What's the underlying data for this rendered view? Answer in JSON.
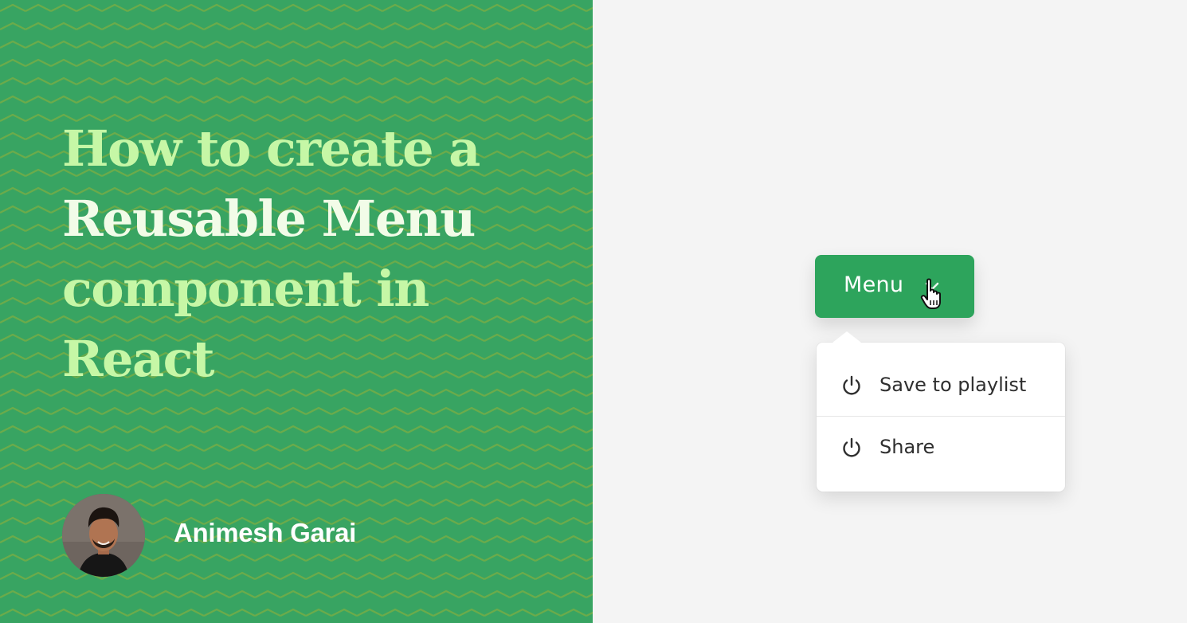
{
  "title": {
    "lines": [
      {
        "text": "How to create a",
        "color": "#c6f7a6"
      },
      {
        "text": "Reusable Menu",
        "color": "#f2fce8"
      },
      {
        "text": "component in",
        "color": "#c6f7a6"
      },
      {
        "text": "React",
        "color": "#c6f7a6"
      }
    ]
  },
  "author": {
    "name": "Animesh Garai",
    "avatar_icon": "avatar-photo"
  },
  "menu_button": {
    "label": "Menu",
    "chevron_icon": "chevron-down-icon",
    "cursor_icon": "hand-pointer-icon",
    "color": "#2da45c"
  },
  "dropdown": {
    "items": [
      {
        "label": "Save to playlist",
        "icon": "power-icon"
      },
      {
        "label": "Share",
        "icon": "power-icon"
      }
    ]
  },
  "colors": {
    "left_background": "#38a462",
    "right_background": "#f4f4f4"
  }
}
